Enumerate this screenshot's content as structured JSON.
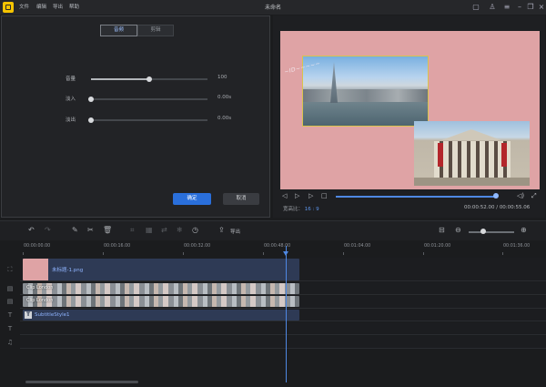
{
  "titlebar": {
    "app_title": "未命名",
    "menu": [
      "文件",
      "编辑",
      "导出",
      "帮助"
    ]
  },
  "props_panel": {
    "tabs": [
      {
        "label": "音频",
        "active": true
      },
      {
        "label": "剪辑",
        "active": false
      }
    ],
    "sliders": [
      {
        "label": "音量",
        "value": "100",
        "fraction": 0.5
      },
      {
        "label": "淡入",
        "value": "0.00s",
        "fraction": 0.0
      },
      {
        "label": "淡出",
        "value": "0.00s",
        "fraction": 0.0
      }
    ],
    "ok_label": "确定",
    "cancel_label": "取消"
  },
  "preview": {
    "watermark": "~ID~~~~~",
    "aspect_label": "宽高比：",
    "aspect_value": "16 : 9",
    "time_current": "00:00:52.00",
    "time_separator": "/",
    "time_total": "00:00:55.06",
    "progress_fraction": 0.94
  },
  "toolbar": {
    "export_label": "导出",
    "zoom_fraction": 0.3
  },
  "timeline": {
    "ruler_labels": [
      "00:00:00.00",
      "00:00:16.00",
      "00:00:32.00",
      "00:00:48.00",
      "00:01:04.00",
      "00:01:20.00",
      "00:01:36.00"
    ],
    "image_clip_label": "未标题-1.png",
    "video_clip_label_1": "Clip London",
    "video_clip_label_2": "Clip London",
    "subtitle_label": "SubtitleStyle1"
  },
  "colors": {
    "accent": "#2a6fdb",
    "canvas_bg": "#dfa3a5",
    "clip_bg": "#2e3a55"
  }
}
